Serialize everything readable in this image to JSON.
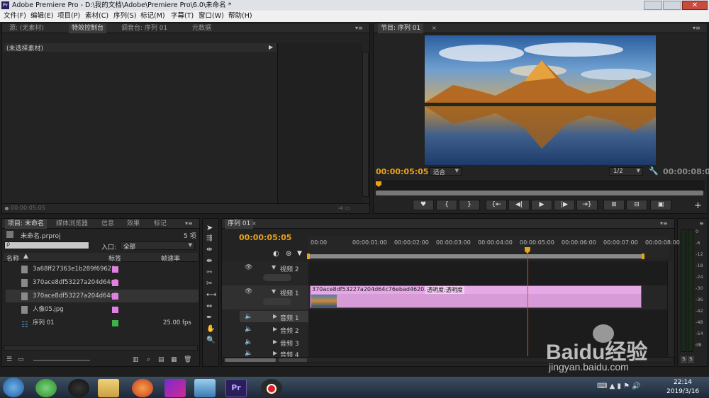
{
  "titlebar": {
    "logo": "Pr",
    "title": "Adobe Premiere Pro - D:\\我的文档\\Adobe\\Premiere Pro\\6.0\\未命名 *"
  },
  "menu": [
    "文件(F)",
    "编辑(E)",
    "项目(P)",
    "素材(C)",
    "序列(S)",
    "标记(M)",
    "字幕(T)",
    "窗口(W)",
    "帮助(H)"
  ],
  "source_panel": {
    "tabs": [
      "源: (无素材)",
      "特效控制台",
      "调音台: 序列 01",
      "元数据"
    ],
    "active_tab": "特效控制台",
    "header": "(未选择素材)",
    "timecode": "00:00:05:05"
  },
  "program_panel": {
    "tab": "节目: 序列 01",
    "timecode": "00:00:05:05",
    "fit": "适合",
    "resolution": "1/2",
    "duration": "00:00:08:00",
    "playhead_fraction": 0.0
  },
  "project_panel": {
    "tabs": [
      "项目: 未命名",
      "媒体浏览器",
      "信息",
      "效果",
      "标记"
    ],
    "filename": "未命名.prproj",
    "count": "5 项",
    "search_placeholder": "ρ˜",
    "entry_label": "入口:",
    "entry_value": "全部",
    "col_name": "名称",
    "col_label": "标签",
    "col_fps": "帧速率",
    "items": [
      {
        "name": "3a68ff27363e1b289f69628c",
        "color": "#e080e0",
        "fps": ""
      },
      {
        "name": "370ace8df53227a204d64c7",
        "color": "#e080e0",
        "fps": ""
      },
      {
        "name": "370ace8df53227a204d64c7",
        "color": "#e080e0",
        "fps": ""
      },
      {
        "name": "人像05.jpg",
        "color": "#e080e0",
        "fps": ""
      },
      {
        "name": "序列 01",
        "color": "#3fb04a",
        "fps": "25.00 fps"
      }
    ]
  },
  "timeline": {
    "tab": "序列 01",
    "timecode": "00:00:05:05",
    "ruler": [
      "00:00",
      "00:00:01:00",
      "00:00:02:00",
      "00:00:03:00",
      "00:00:04:00",
      "00:00:05:00",
      "00:00:06:00",
      "00:00:07:00",
      "00:00:08:00"
    ],
    "tracks": {
      "v2": "视频 2",
      "v1": "视频 1",
      "a1": "音频 1",
      "a2": "音频 2",
      "a3": "音频 3",
      "a4": "音频 4"
    },
    "clip_name": "370ace8df53227a204d64c76ebad4620.jpg",
    "clip_fx": "透明度:透明度",
    "playhead_seconds": 5.2
  },
  "meters": {
    "labels": [
      "0",
      "-6",
      "-12",
      "-18",
      "-24",
      "-30",
      "-36",
      "-42",
      "-48",
      "-54",
      "dB"
    ],
    "solo": "S"
  },
  "taskbar": {
    "time": "22:14",
    "date": "2019/3/16"
  },
  "watermark": {
    "brand": "Baidu经验",
    "url": "jingyan.baidu.com"
  }
}
